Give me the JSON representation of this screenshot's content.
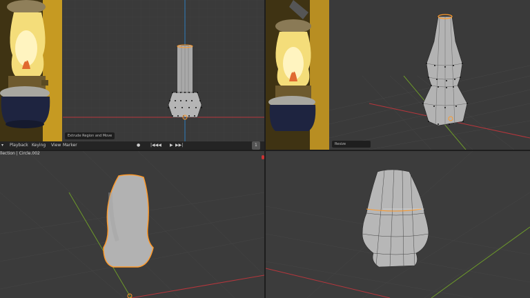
{
  "viewport_tl": {
    "operator_label": "Extrude Region and Move",
    "timeline": {
      "playback_label": "Playback",
      "keying_label": "Keying",
      "view_label": "View",
      "marker_label": "Marker",
      "frame_value": "1"
    }
  },
  "viewport_tr": {
    "operator_label": "Resize"
  },
  "viewport_bl": {
    "collection_label": "llection | Circle.002"
  },
  "colors": {
    "selection_orange": "#ff9a2a",
    "x_axis_red": "#b8363c",
    "y_axis_green": "#6d9a2a",
    "z_axis_blue": "#2f7fc0",
    "mesh_gray": "#bdbdbd"
  },
  "icons": [
    "transform-arrows-icon",
    "play-icon",
    "jump-start-icon",
    "jump-end-icon",
    "keyframe-icon",
    "origin-icon"
  ]
}
